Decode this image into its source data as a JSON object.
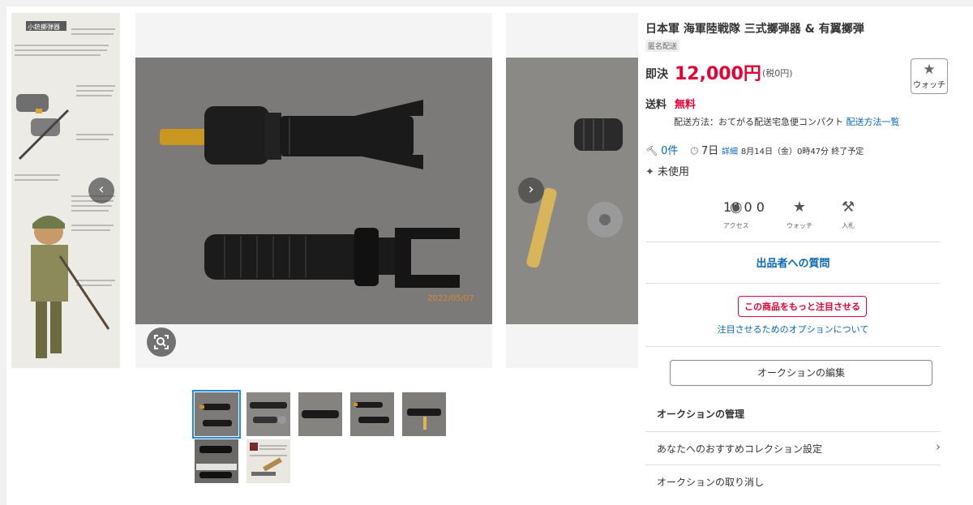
{
  "listing": {
    "title": "日本軍 海軍陸戦隊 三式擲弾器 & 有翼擲弾",
    "anon_badge": "匿名配送",
    "price_label": "即決",
    "price": "12,000円",
    "tax_note": "(税0円)",
    "watch_label": "ウォッチ",
    "shipping_label": "送料",
    "shipping_value": "無料",
    "shipping_method": "配送方法：おてがる配送宅急便コンパクト",
    "shipping_link": "配送方法一覧",
    "bids": "0件",
    "days_left": "7日",
    "detail_link": "詳細",
    "end_time": "8月14日（金）0時47分 終了予定",
    "condition": "未使用"
  },
  "stats": {
    "access_label": "アクセス",
    "access_count": "10",
    "watch_label": "ウォッチ",
    "watch_count": "0",
    "bid_label": "入札",
    "bid_count": "0"
  },
  "actions": {
    "question": "出品者への質問",
    "promote": "この商品をもっと注目させる",
    "promote_link": "注目させるためのオプションについて",
    "edit": "オークションの編集",
    "management_title": "オークションの管理",
    "collection_setting": "あなたへのおすすめコレクション設定",
    "cancel": "オークションの取り消し"
  },
  "gallery": {
    "thumbnail_count": 7,
    "selected_thumbnail": 1,
    "photo_watermark": "2022/05/07",
    "manual_heading": "小銃擲弾器"
  },
  "colors": {
    "price_red": "#e60033",
    "link_blue": "#0868b7",
    "thumb_border": "#1e88e5"
  }
}
